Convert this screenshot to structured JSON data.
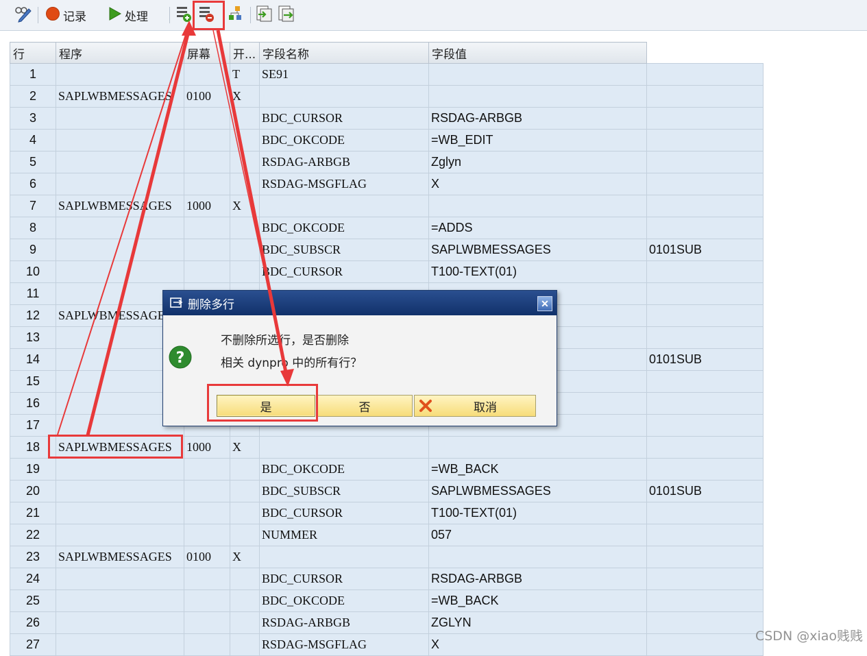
{
  "toolbar": {
    "record_label": "记录",
    "process_label": "处理"
  },
  "columns": [
    "行",
    "程序",
    "屏幕",
    "开...",
    "字段名称",
    "字段值",
    ""
  ],
  "rows": [
    [
      "1",
      "",
      "",
      "T",
      "SE91",
      "",
      ""
    ],
    [
      "2",
      "SAPLWBMESSAGES",
      "0100",
      "X",
      "",
      "",
      ""
    ],
    [
      "3",
      "",
      "",
      "",
      "BDC_CURSOR",
      "RSDAG-ARBGB",
      ""
    ],
    [
      "4",
      "",
      "",
      "",
      "BDC_OKCODE",
      "=WB_EDIT",
      ""
    ],
    [
      "5",
      "",
      "",
      "",
      "RSDAG-ARBGB",
      "Zglyn",
      ""
    ],
    [
      "6",
      "",
      "",
      "",
      "RSDAG-MSGFLAG",
      "X",
      ""
    ],
    [
      "7",
      "SAPLWBMESSAGES",
      "1000",
      "X",
      "",
      "",
      ""
    ],
    [
      "8",
      "",
      "",
      "",
      "BDC_OKCODE",
      "=ADDS",
      ""
    ],
    [
      "9",
      "",
      "",
      "",
      "BDC_SUBSCR",
      "SAPLWBMESSAGES",
      "0101SUB"
    ],
    [
      "10",
      "",
      "",
      "",
      "BDC_CURSOR",
      "T100-TEXT(01)",
      ""
    ],
    [
      "11",
      "",
      "",
      "",
      "",
      "",
      ""
    ],
    [
      "12",
      "SAPLWBMESSAGE",
      "",
      "",
      "",
      "",
      ""
    ],
    [
      "13",
      "",
      "",
      "",
      "",
      "",
      ""
    ],
    [
      "14",
      "",
      "",
      "",
      "",
      "",
      "0101SUB"
    ],
    [
      "15",
      "",
      "",
      "",
      "",
      "",
      ""
    ],
    [
      "16",
      "",
      "",
      "",
      "",
      "",
      ""
    ],
    [
      "17",
      "",
      "",
      "",
      "",
      "",
      ""
    ],
    [
      "18",
      "SAPLWBMESSAGES",
      "1000",
      "X",
      "",
      "",
      ""
    ],
    [
      "19",
      "",
      "",
      "",
      "BDC_OKCODE",
      "=WB_BACK",
      ""
    ],
    [
      "20",
      "",
      "",
      "",
      "BDC_SUBSCR",
      "SAPLWBMESSAGES",
      "0101SUB"
    ],
    [
      "21",
      "",
      "",
      "",
      "BDC_CURSOR",
      "T100-TEXT(01)",
      ""
    ],
    [
      "22",
      "",
      "",
      "",
      "NUMMER",
      "057",
      ""
    ],
    [
      "23",
      "SAPLWBMESSAGES",
      "0100",
      "X",
      "",
      "",
      ""
    ],
    [
      "24",
      "",
      "",
      "",
      "BDC_CURSOR",
      "RSDAG-ARBGB",
      ""
    ],
    [
      "25",
      "",
      "",
      "",
      "BDC_OKCODE",
      "=WB_BACK",
      ""
    ],
    [
      "26",
      "",
      "",
      "",
      "RSDAG-ARBGB",
      "ZGLYN",
      ""
    ],
    [
      "27",
      "",
      "",
      "",
      "RSDAG-MSGFLAG",
      "X",
      ""
    ]
  ],
  "dialog": {
    "title": "删除多行",
    "message_line1": "不删除所选行，是否删除",
    "message_line2": "相关 dynpro 中的所有行？",
    "yes_label": "是",
    "no_label": "否",
    "cancel_label": "取消"
  },
  "watermark": "CSDN @xiao贱贱",
  "colors": {
    "annotation_red": "#e8393a",
    "grid_cell": "#dfeaf5",
    "dialog_title": "#1c3d7a",
    "button_yellow": "#f7dc79"
  }
}
